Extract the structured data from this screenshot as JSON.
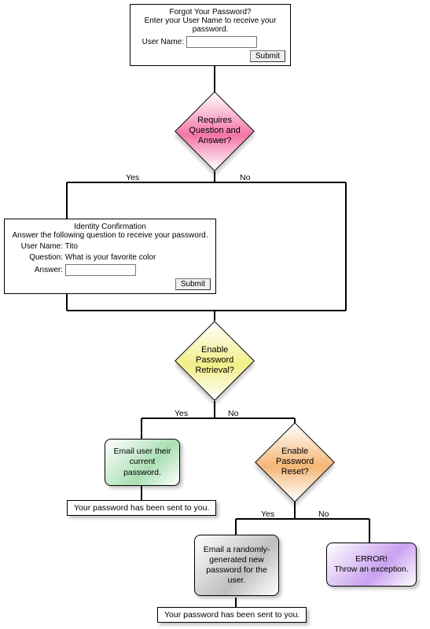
{
  "forgot": {
    "title": "Forgot Your Password?",
    "subtitle": "Enter your User Name to receive your password.",
    "userLabel": "User Name:",
    "userValue": "",
    "submit": "Submit"
  },
  "identity": {
    "title": "Identity Confirmation",
    "subtitle": "Answer the following question to receive your password.",
    "userLabel": "User Name:",
    "userValue": "Tito",
    "questionLabel": "Question:",
    "questionValue": "What is your favorite color",
    "answerLabel": "Answer:",
    "answerValue": "",
    "submit": "Submit"
  },
  "decisions": {
    "qna": "Requires Question and Answer?",
    "retrieval": "Enable Password Retrieval?",
    "reset": "Enable Password Reset?"
  },
  "actions": {
    "emailCurrent": "Email user their current password.",
    "emailNew": "Email a randomly-generated new password for the user.",
    "error": "ERROR!\nThrow an exception."
  },
  "results": {
    "sent1": "Your password has been sent to you.",
    "sent2": "Your password has been sent to you."
  },
  "labels": {
    "yes": "Yes",
    "no": "No"
  }
}
